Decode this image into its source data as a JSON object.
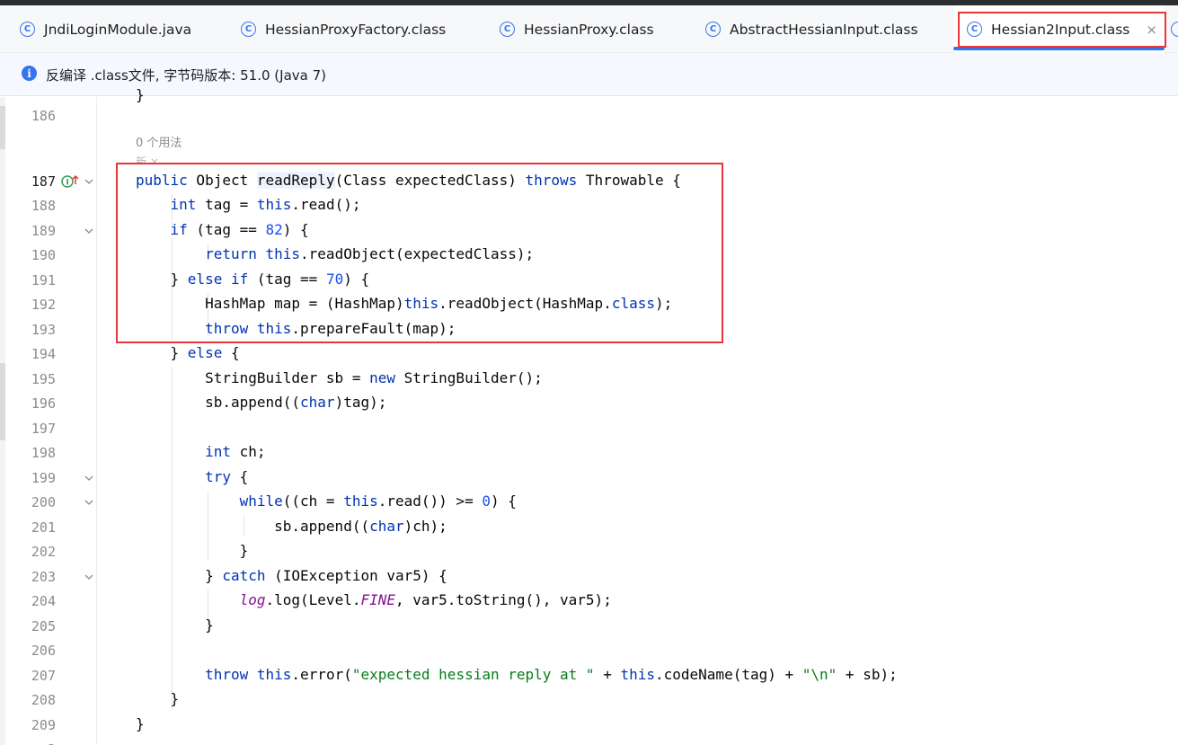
{
  "tabs": [
    {
      "label": "JndiLoginModule.java",
      "active": false
    },
    {
      "label": "HessianProxyFactory.class",
      "active": false
    },
    {
      "label": "HessianProxy.class",
      "active": false
    },
    {
      "label": "AbstractHessianInput.class",
      "active": false
    },
    {
      "label": "Hessian2Input.class",
      "active": true
    }
  ],
  "tab_icon": "C",
  "tab_close_glyph": "×",
  "info": {
    "icon": "i",
    "text": "反编译 .class文件, 字节码版本: 51.0 (Java 7)"
  },
  "hints": {
    "usages": "0 个用法",
    "author": "新 ×"
  },
  "line_numbers": [
    "186",
    "187",
    "188",
    "189",
    "190",
    "191",
    "192",
    "193",
    "194",
    "195",
    "196",
    "197",
    "198",
    "199",
    "200",
    "201",
    "202",
    "203",
    "204",
    "205",
    "206",
    "207",
    "208",
    "209"
  ],
  "code": {
    "l186": "",
    "l187": [
      "public",
      " Object ",
      "readReply",
      "(Class expectedClass) ",
      "throws",
      " Throwable {"
    ],
    "l188": [
      "    ",
      "int",
      " tag = ",
      "this",
      ".read();"
    ],
    "l189": [
      "    ",
      "if",
      " (tag == ",
      "82",
      ") {"
    ],
    "l190": [
      "        ",
      "return",
      " ",
      "this",
      ".readObject(expectedClass);"
    ],
    "l191": [
      "    } ",
      "else",
      " ",
      "if",
      " (tag == ",
      "70",
      ") {"
    ],
    "l192": [
      "        HashMap map = (HashMap)",
      "this",
      ".readObject(HashMap.",
      "class",
      ");"
    ],
    "l193": [
      "        ",
      "throw",
      " ",
      "this",
      ".prepareFault(map);"
    ],
    "l194": [
      "    } ",
      "else",
      " {"
    ],
    "l195": [
      "        StringBuilder sb = ",
      "new",
      " StringBuilder();"
    ],
    "l196": [
      "        sb.append((",
      "char",
      ")tag);"
    ],
    "l197": "",
    "l198": [
      "        ",
      "int",
      " ch;"
    ],
    "l199": [
      "        ",
      "try",
      " {"
    ],
    "l200": [
      "            ",
      "while",
      "((ch = ",
      "this",
      ".read()) >= ",
      "0",
      ") {"
    ],
    "l201": [
      "                sb.append((",
      "char",
      ")ch);"
    ],
    "l202": "            }",
    "l203": [
      "        } ",
      "catch",
      " (IOException var5) {"
    ],
    "l204": [
      "            ",
      "log",
      ".log(Level.",
      "FINE",
      ", var5.toString(), var5);"
    ],
    "l205": "        }",
    "l206": "",
    "l207": [
      "        ",
      "throw",
      " ",
      "this",
      ".error(",
      "\"expected hessian reply at \"",
      " + ",
      "this",
      ".codeName(tag) + ",
      "\"\\n\"",
      " + sb);"
    ],
    "l208": "    }",
    "l209": "}"
  },
  "colors": {
    "keyword": "#0033b3",
    "number": "#1750eb",
    "string": "#067d17",
    "field": "#871094",
    "accent": "#3574f0",
    "highlight_box": "#e8373a"
  }
}
